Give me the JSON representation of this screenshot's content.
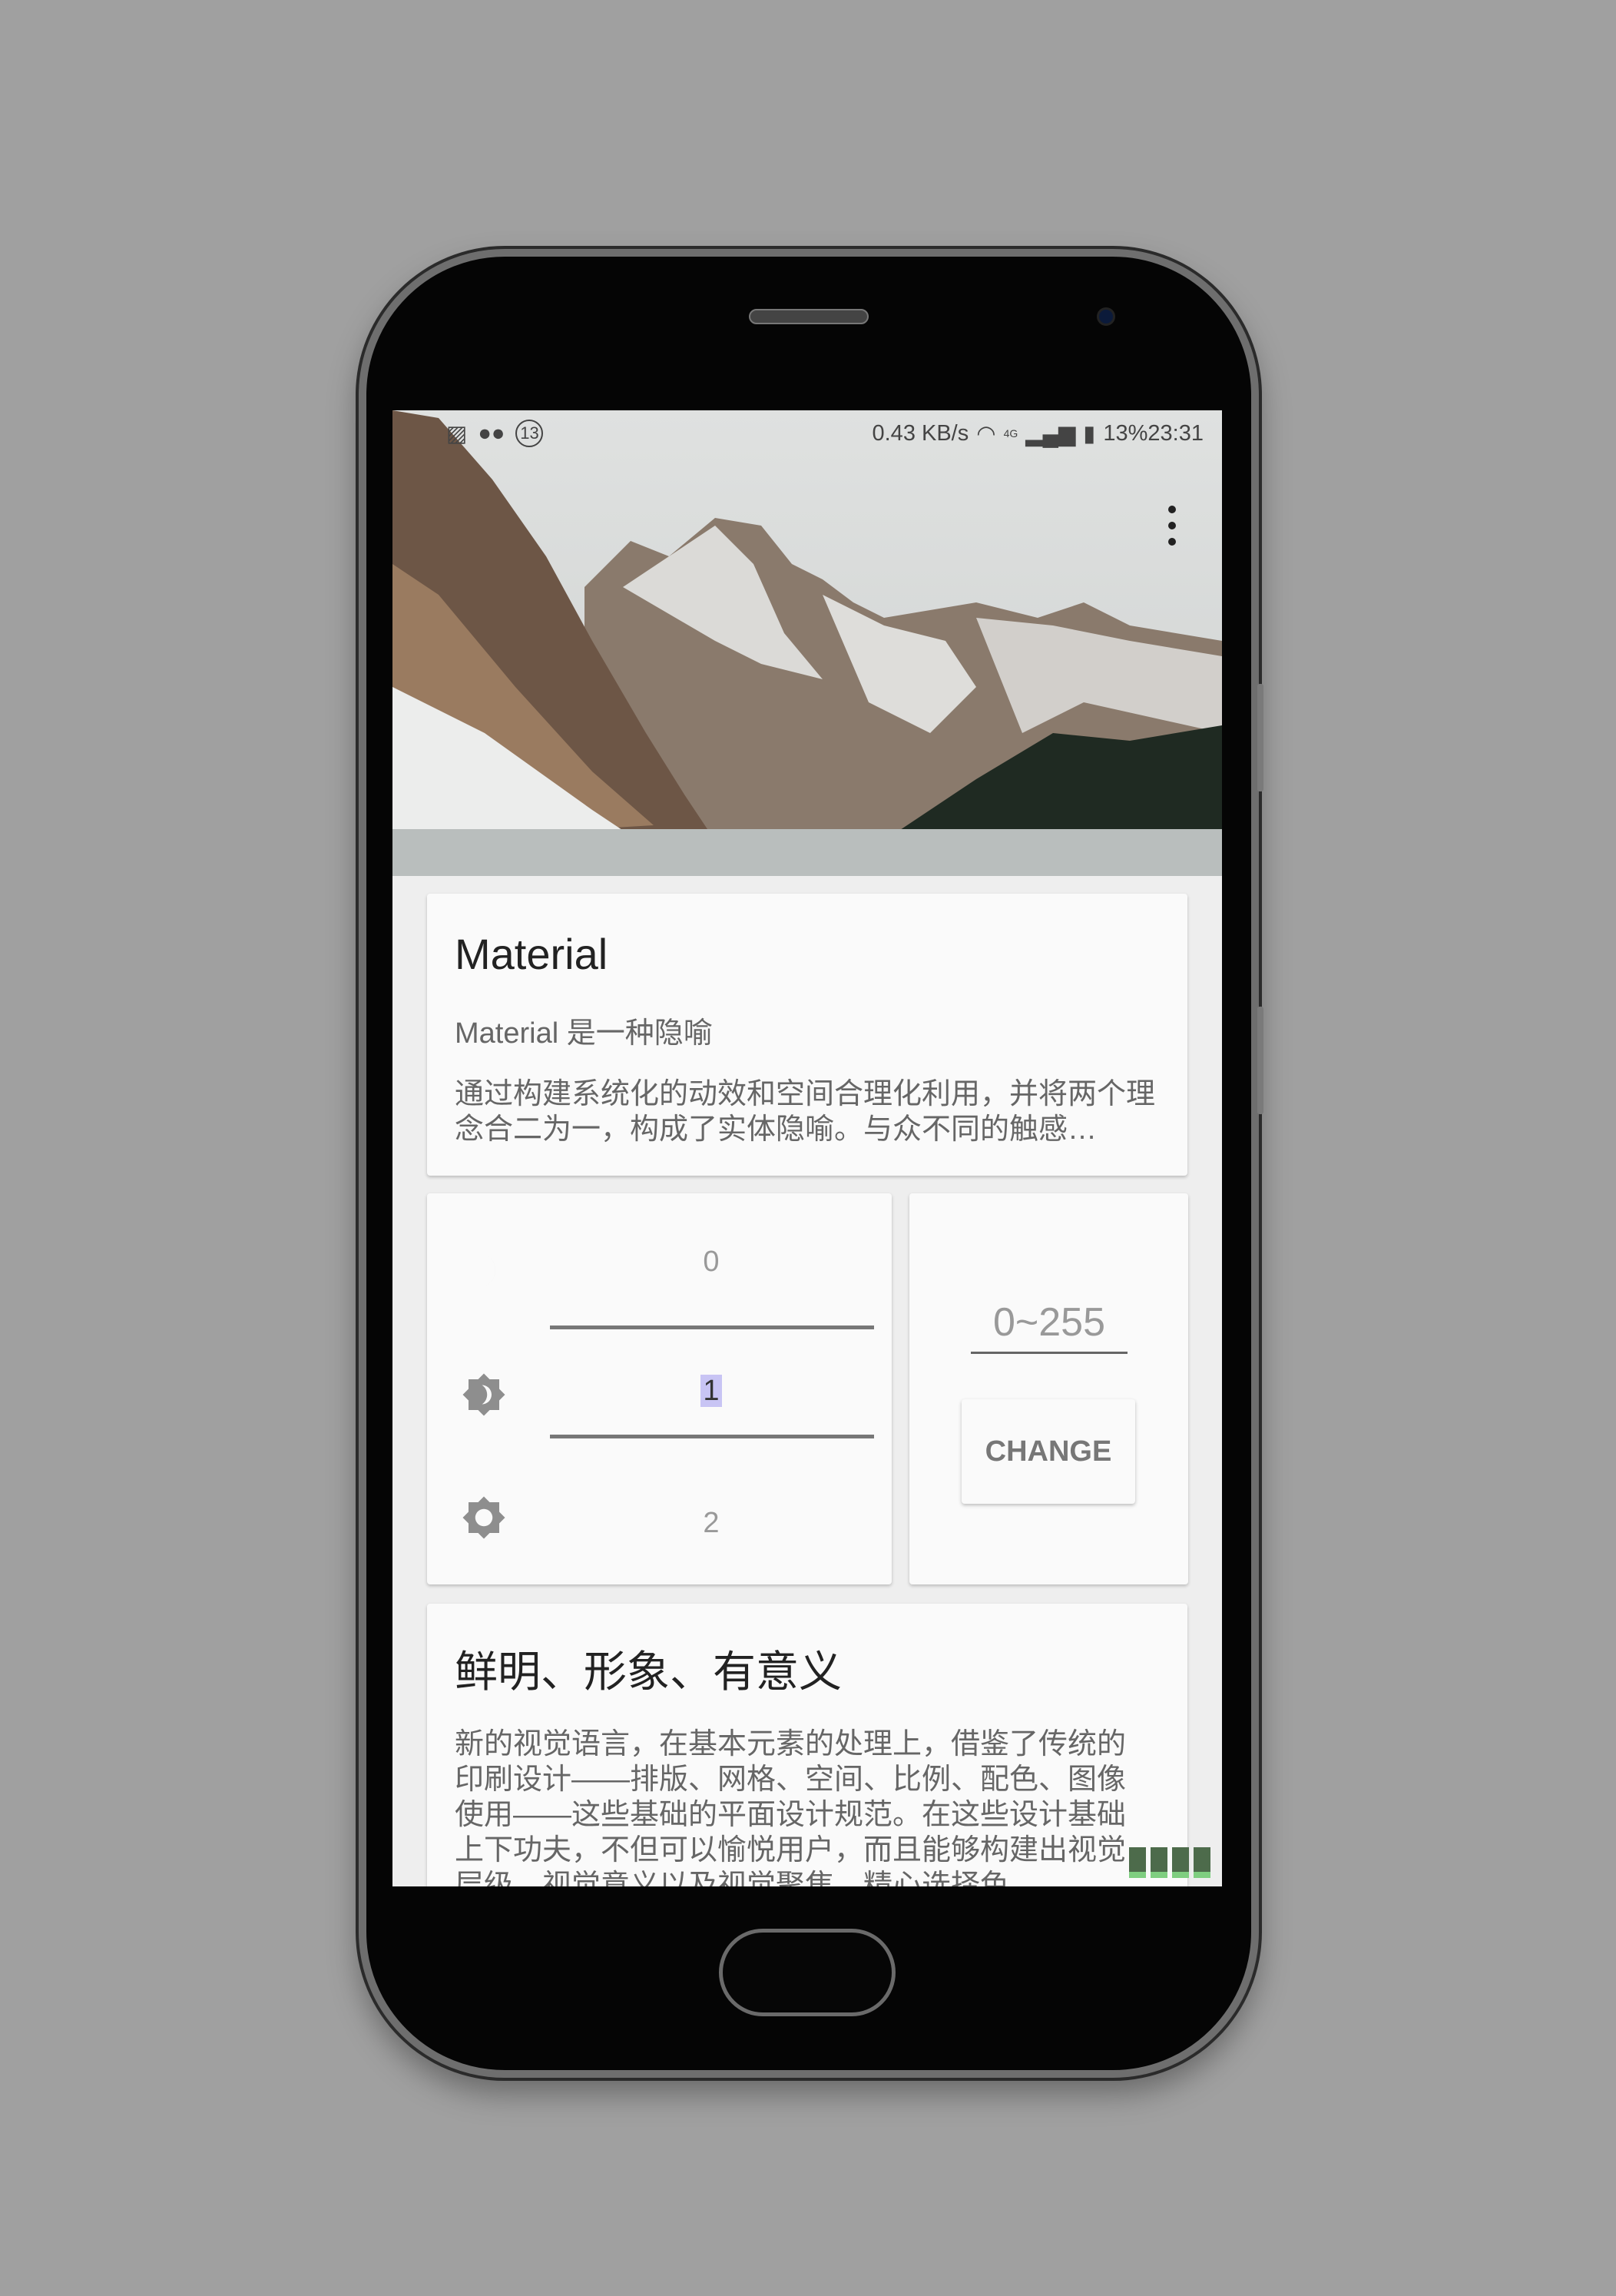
{
  "status_bar": {
    "left_icons": [
      "gallery-icon",
      "wechat-icon",
      "notification-count-icon"
    ],
    "notification_count": "13",
    "net_speed": "0.43 KB/s",
    "network": "4G",
    "battery": "13%",
    "time": "23:31"
  },
  "header": {
    "image": "mountain-lake-photo",
    "menu_icon": "more-vert-icon"
  },
  "card_material": {
    "title": "Material",
    "subtitle": "Material 是一种隐喻",
    "body": "通过构建系统化的动效和空间合理化利用，并将两个理念合二为一，构成了实体隐喻。与众不同的触感…"
  },
  "mode_picker": {
    "options": [
      {
        "icon": "night-mode-icon",
        "value": "0"
      },
      {
        "icon": "auto-brightness-icon",
        "value": "1"
      },
      {
        "icon": "day-mode-icon",
        "value": "2"
      }
    ],
    "selected": "1"
  },
  "range_card": {
    "input_value": "0~255",
    "button_label": "CHANGE"
  },
  "card_meaning": {
    "title": "鲜明、形象、有意义",
    "body": "新的视觉语言，在基本元素的处理上，借鉴了传统的印刷设计——排版、网格、空间、比例、配色、图像使用——这些基础的平面设计规范。在这些设计基础上下功夫，不但可以愉悦用户，而且能够构建出视觉层级、视觉意义以及视觉聚焦。精心选择色"
  }
}
